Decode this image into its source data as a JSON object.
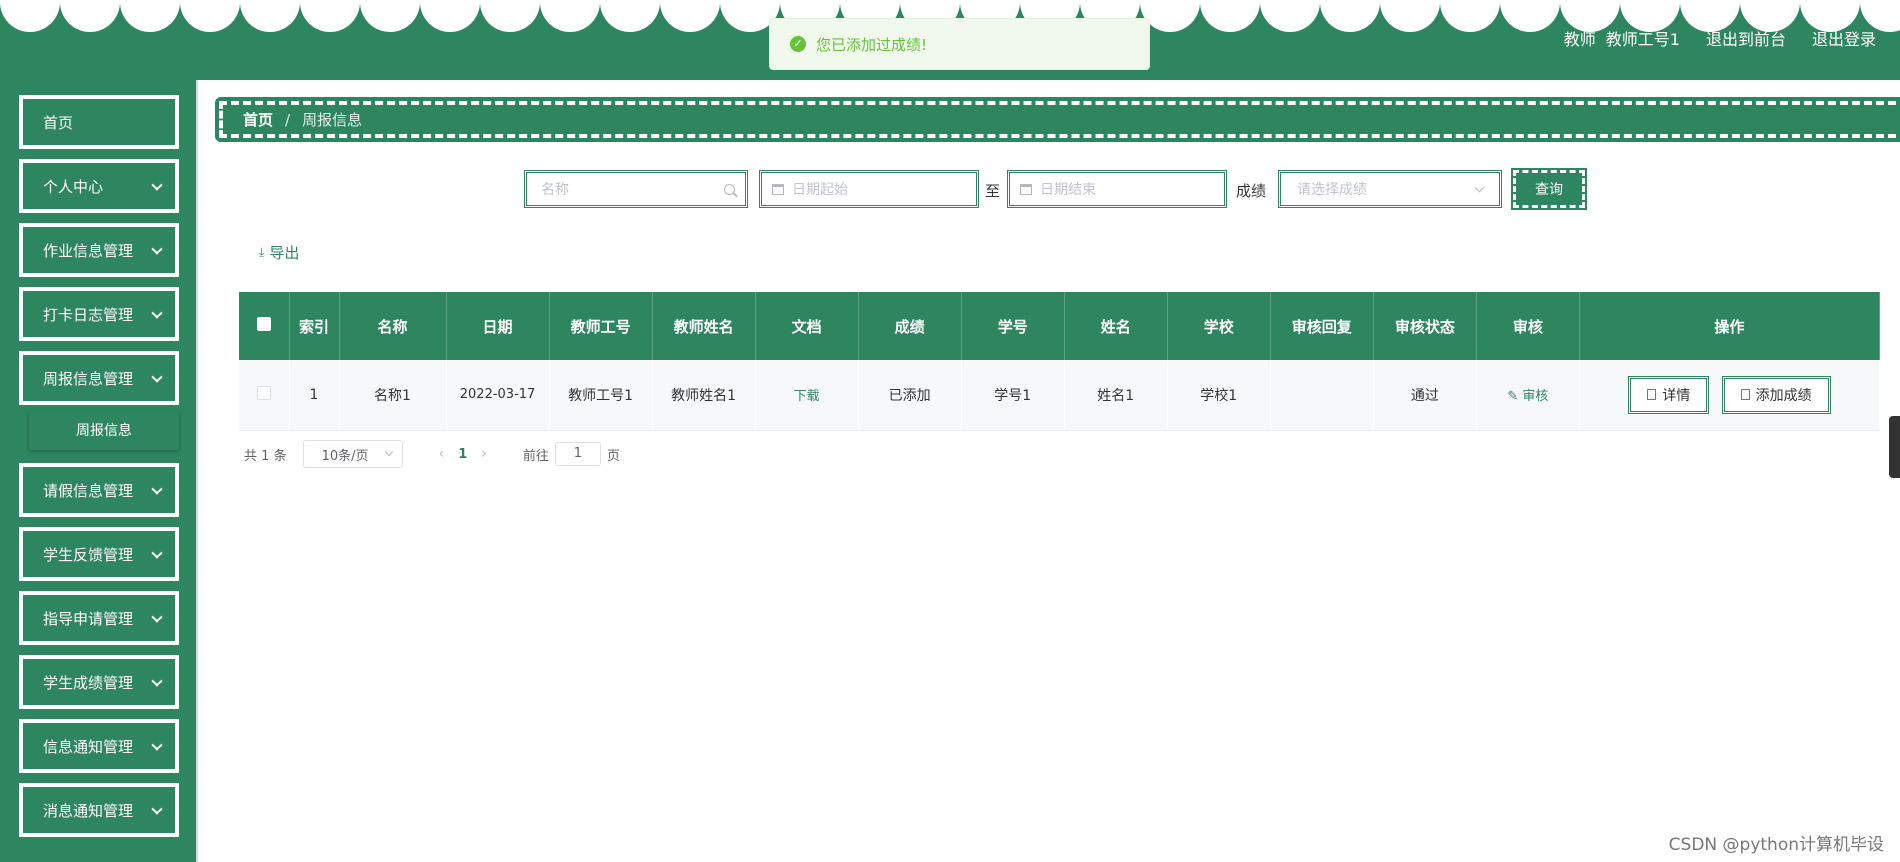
{
  "colors": {
    "primary": "#2e8660",
    "toast_bg": "#f0f9eb",
    "toast_text": "#67c23a"
  },
  "header": {
    "role": "教师",
    "user": "教师工号1",
    "to_front": "退出到前台",
    "logout": "退出登录"
  },
  "toast": {
    "icon": "check-circle-icon",
    "text": "您已添加过成绩!"
  },
  "sidebar": {
    "items": [
      {
        "label": "首页",
        "has_chevron": false
      },
      {
        "label": "个人中心",
        "has_chevron": true
      },
      {
        "label": "作业信息管理",
        "has_chevron": true
      },
      {
        "label": "打卡日志管理",
        "has_chevron": true
      },
      {
        "label": "周报信息管理",
        "has_chevron": true
      },
      {
        "label": "请假信息管理",
        "has_chevron": true
      },
      {
        "label": "学生反馈管理",
        "has_chevron": true
      },
      {
        "label": "指导申请管理",
        "has_chevron": true
      },
      {
        "label": "学生成绩管理",
        "has_chevron": true
      },
      {
        "label": "信息通知管理",
        "has_chevron": true
      },
      {
        "label": "消息通知管理",
        "has_chevron": true
      }
    ],
    "submenu": {
      "label": "周报信息"
    }
  },
  "breadcrumb": {
    "home": "首页",
    "separator": "/",
    "current": "周报信息"
  },
  "search": {
    "name_placeholder": "名称",
    "date_start_placeholder": "日期起始",
    "to_label": "至",
    "date_end_placeholder": "日期结束",
    "grade_label": "成绩",
    "grade_placeholder": "请选择成绩",
    "query_label": "查询"
  },
  "toolbar": {
    "export_label": "导出"
  },
  "table": {
    "columns": [
      "索引",
      "名称",
      "日期",
      "教师工号",
      "教师姓名",
      "文档",
      "成绩",
      "学号",
      "姓名",
      "学校",
      "审核回复",
      "审核状态",
      "审核",
      "操作"
    ],
    "rows": [
      {
        "index": "1",
        "name": "名称1",
        "date": "2022-03-17",
        "teacher_id": "教师工号1",
        "teacher_name": "教师姓名1",
        "document": "下载",
        "grade": "已添加",
        "student_id": "学号1",
        "student_name": "姓名1",
        "school": "学校1",
        "review_reply": "",
        "review_status": "通过",
        "review_action": "审核",
        "detail_label": "详情",
        "add_grade_label": "添加成绩"
      }
    ]
  },
  "pagination": {
    "total_prefix": "共",
    "total": "1",
    "total_suffix": "条",
    "page_size": "10条/页",
    "prev": "‹",
    "current_page": "1",
    "next": "›",
    "goto_prefix": "前往",
    "goto_value": "1",
    "goto_suffix": "页"
  },
  "watermark": "CSDN @python计算机毕设"
}
